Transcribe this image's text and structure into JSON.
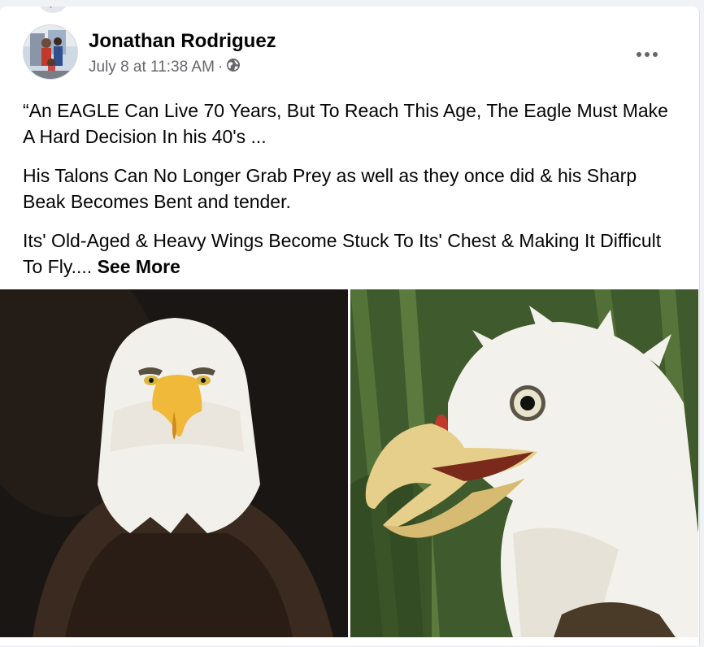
{
  "post": {
    "author": "Jonathan Rodriguez",
    "date": "July 8 at 11:38 AM",
    "separator": "·",
    "privacy_icon": "globe-icon",
    "more_icon": "ellipsis-icon",
    "paragraphs": [
      "“An EAGLE Can Live 70 Years, But To Reach This Age, The Eagle Must Make A Hard Decision In his 40's ...",
      "His Talons Can No Longer Grab Prey as well as they once did & his Sharp Beak Becomes Bent and tender.",
      "Its' Old-Aged & Heavy Wings Become Stuck To Its' Chest & Making It Difficult To Fly...."
    ],
    "see_more": "See More",
    "photos": [
      {
        "icon": "bald-eagle-young-photo"
      },
      {
        "icon": "bald-eagle-old-photo"
      }
    ]
  },
  "colors": {
    "background": "#f0f2f5",
    "card": "#ffffff",
    "text": "#050505",
    "secondary_text": "#65676b"
  }
}
